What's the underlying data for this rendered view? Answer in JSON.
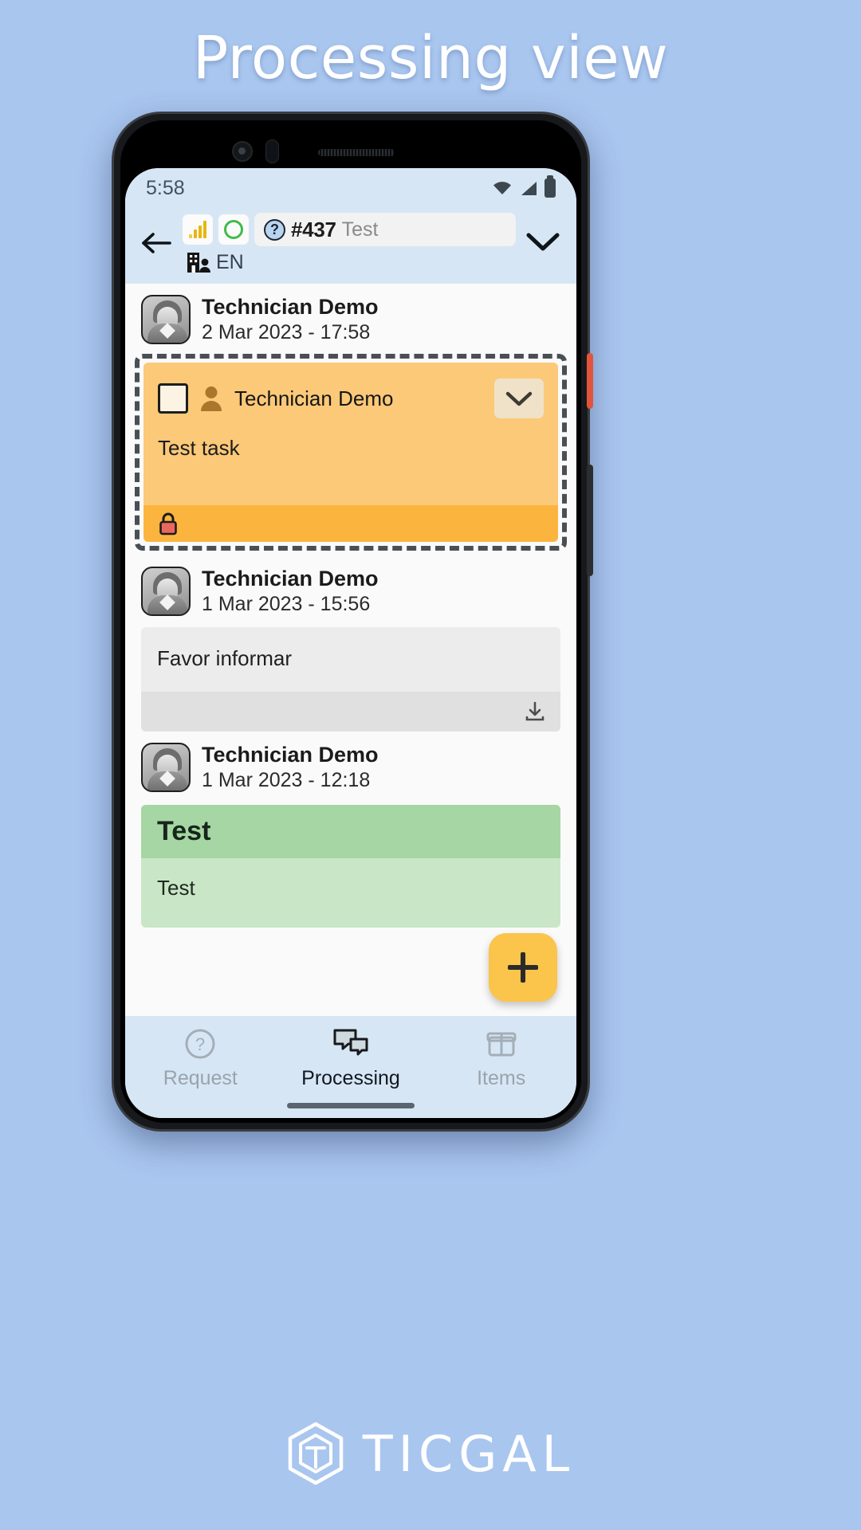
{
  "page": {
    "heading": "Processing view",
    "brand_name": "TICGAL"
  },
  "status_bar": {
    "time": "5:58",
    "icons": [
      "wifi-icon",
      "cellular-signal-icon",
      "battery-icon"
    ]
  },
  "app_bar": {
    "back_icon": "arrow-left-icon",
    "signal_chip_icon": "signal-bars-icon",
    "status_circle_icon": "circle-outline-icon",
    "ticket": {
      "help_icon": "question-mark-icon",
      "id": "#437",
      "name": "Test"
    },
    "org_icon": "building-person-icon",
    "language": "EN",
    "expand_icon": "chevron-down-icon"
  },
  "feed": [
    {
      "author": "Technician Demo",
      "timestamp": "2 Mar 2023 - 17:58",
      "avatar": "user-avatar",
      "card": {
        "kind": "task",
        "selected": true,
        "checkbox_checked": false,
        "assignee_icon": "person-icon",
        "assignee": "Technician Demo",
        "expand_icon": "chevron-down-icon",
        "text": "Test task",
        "footer_icon": "lock-icon"
      }
    },
    {
      "author": "Technician Demo",
      "timestamp": "1 Mar 2023 - 15:56",
      "avatar": "user-avatar",
      "card": {
        "kind": "note",
        "text": "Favor informar",
        "attachment_icon": "download-icon"
      }
    },
    {
      "author": "Technician Demo",
      "timestamp": "1 Mar 2023 - 12:18",
      "avatar": "user-avatar",
      "card": {
        "kind": "solution",
        "header": "Test",
        "text": "Test"
      }
    }
  ],
  "fab": {
    "icon": "plus-icon",
    "color": "#fbc44a"
  },
  "bottom_nav": {
    "items": [
      {
        "label": "Request",
        "icon": "question-circle-icon",
        "active": false
      },
      {
        "label": "Processing",
        "icon": "chat-bubbles-icon",
        "active": true
      },
      {
        "label": "Items",
        "icon": "box-icon",
        "active": false
      }
    ]
  },
  "colors": {
    "page_background": "#a9c6ef",
    "app_bar": "#d6e6f5",
    "task_card": "#fbc978",
    "task_card_footer": "#fbb53f",
    "note_card": "#ececec",
    "solution_card": "#c9e7c6",
    "solution_header": "#a6d6a3",
    "accent": "#fbc44a"
  }
}
